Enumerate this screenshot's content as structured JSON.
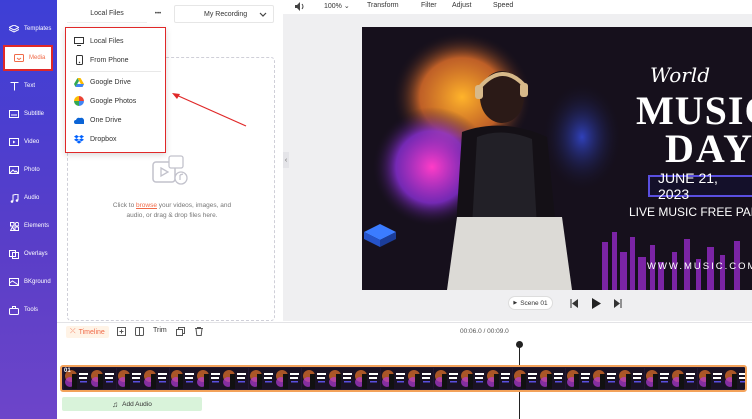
{
  "sidebar": {
    "items": [
      {
        "label": "Templates",
        "icon": "layers-icon"
      },
      {
        "label": "Media",
        "icon": "folder-icon"
      },
      {
        "label": "Text",
        "icon": "text-icon"
      },
      {
        "label": "Subtitle",
        "icon": "subtitle-icon"
      },
      {
        "label": "Video",
        "icon": "video-icon"
      },
      {
        "label": "Photo",
        "icon": "photo-icon"
      },
      {
        "label": "Audio",
        "icon": "music-icon"
      },
      {
        "label": "Elements",
        "icon": "elements-icon"
      },
      {
        "label": "Overlays",
        "icon": "overlays-icon"
      },
      {
        "label": "BKground",
        "icon": "background-icon"
      },
      {
        "label": "Tools",
        "icon": "tools-icon"
      }
    ]
  },
  "panel": {
    "local_files_label": "Local Files",
    "more_label": "•••",
    "recording_label": "My Recording",
    "upload_hint_pre": "Click to ",
    "upload_hint_link": "browse",
    "upload_hint_post": " your videos, images, and audio, or drag & drop files here."
  },
  "menu": {
    "items": [
      {
        "label": "Local Files",
        "icon": "monitor-icon"
      },
      {
        "label": "From Phone",
        "icon": "phone-icon"
      },
      {
        "label": "Google Drive",
        "icon": "google-drive-icon"
      },
      {
        "label": "Google Photos",
        "icon": "google-photos-icon"
      },
      {
        "label": "One Drive",
        "icon": "onedrive-icon"
      },
      {
        "label": "Dropbox",
        "icon": "dropbox-icon"
      }
    ]
  },
  "toolbar": {
    "zoom": "100%",
    "transform": "Transform",
    "filter": "Filter",
    "adjust": "Adjust",
    "speed": "Speed"
  },
  "preview": {
    "title_script": "World",
    "title_line1": "MUSIC",
    "title_line2": "DAY",
    "date": "JUNE 21, 2023",
    "subtitle": "LIVE MUSIC FREE PARK",
    "website": "WWW.MUSIC.COM"
  },
  "player": {
    "scene_label": "Scene 01"
  },
  "timeline": {
    "timeline_label": "Timeline",
    "trim_label": "Trim",
    "time_current": "00:06.0",
    "time_total": "00:09.0",
    "time_separator": " / ",
    "clip_badge": "01",
    "add_audio_label": "Add Audio"
  },
  "colors": {
    "accent": "#f06a48",
    "sidebar": "#4a3fd0",
    "highlight": "#e02828",
    "track_border": "#f3a25a"
  }
}
